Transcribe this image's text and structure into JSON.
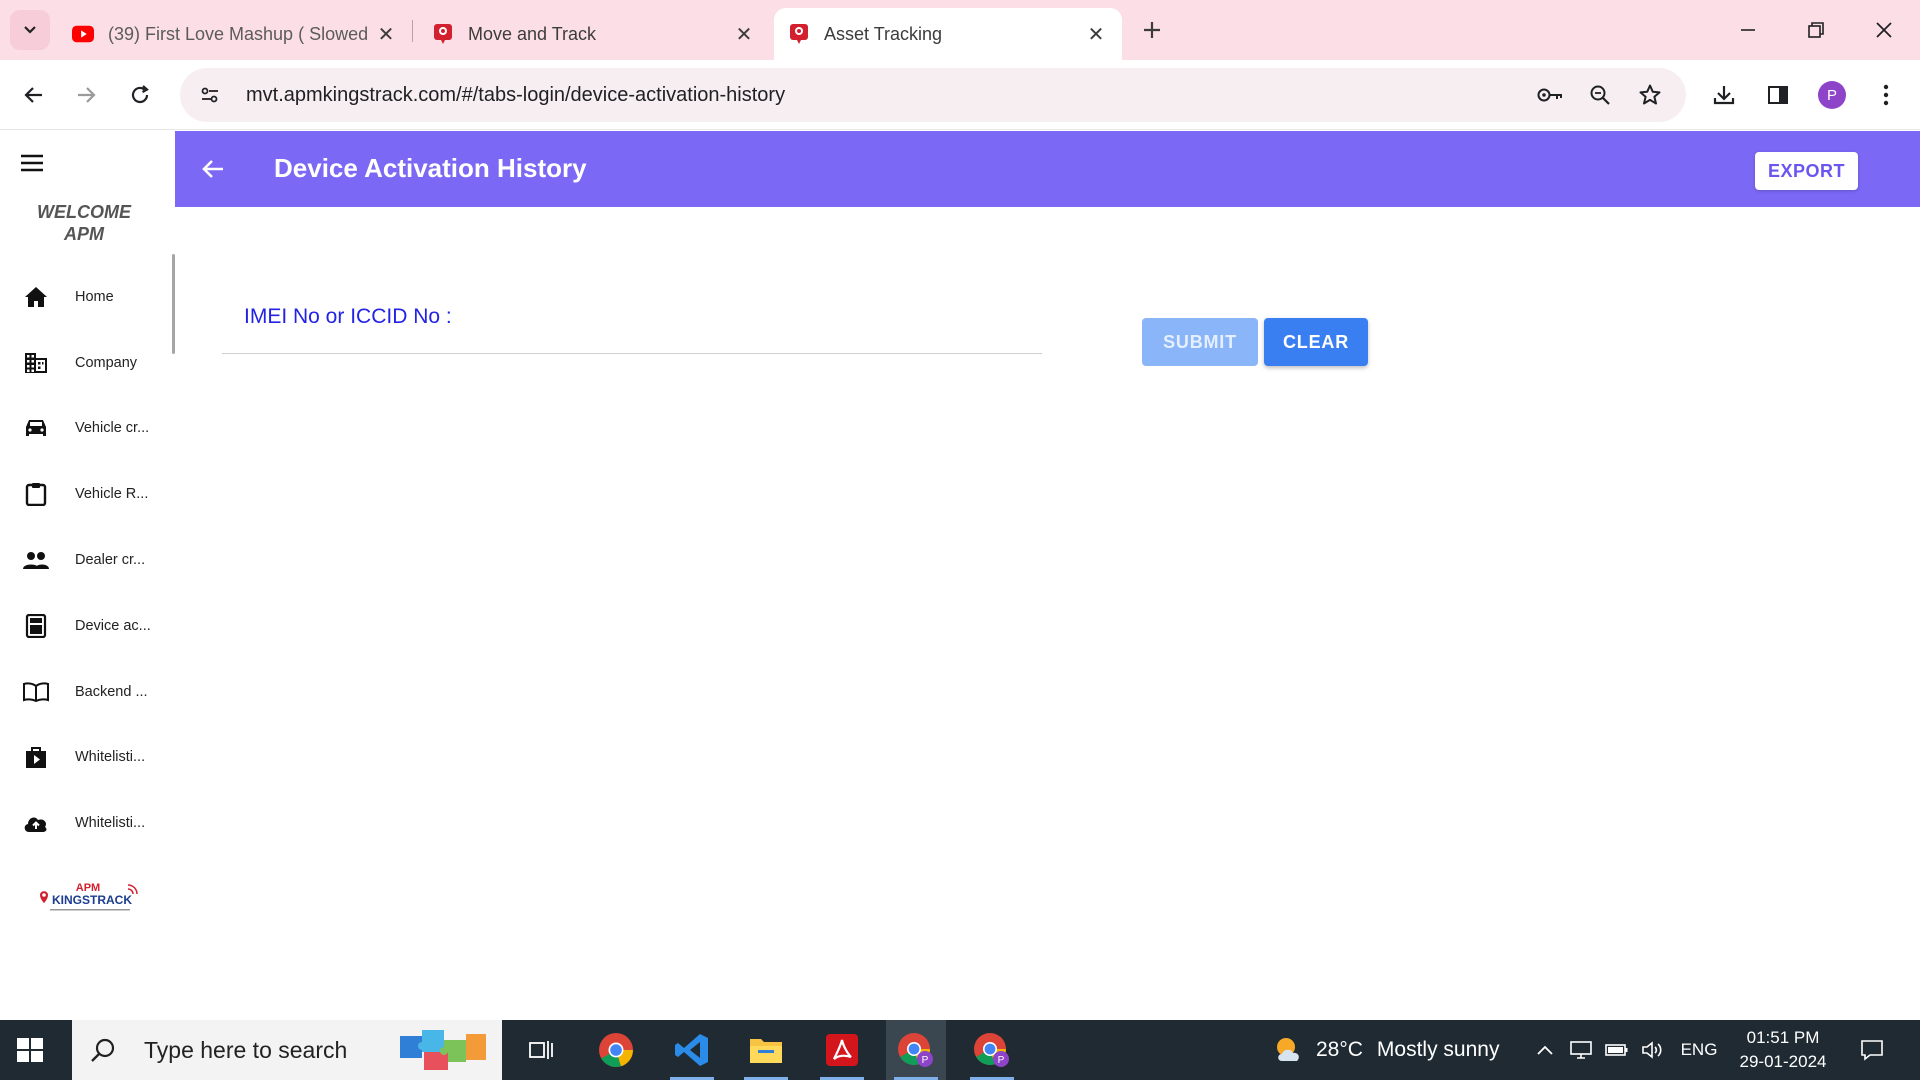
{
  "browser": {
    "tabs": [
      {
        "title": "(39) First Love Mashup ( Slowed",
        "favicon": "youtube-icon",
        "active": false
      },
      {
        "title": "Move and Track",
        "favicon": "location-pin-icon",
        "active": false
      },
      {
        "title": "Asset Tracking",
        "favicon": "location-pin-icon",
        "active": true
      }
    ],
    "url": "mvt.apmkingstrack.com/#/tabs-login/device-activation-history",
    "profile_initial": "P"
  },
  "sidebar": {
    "welcome_line1": "WELCOME",
    "welcome_line2": "APM",
    "items": [
      {
        "label": "Home",
        "icon": "home-icon"
      },
      {
        "label": "Company",
        "icon": "building-icon"
      },
      {
        "label": "Vehicle cr...",
        "icon": "car-icon"
      },
      {
        "label": "Vehicle R...",
        "icon": "clipboard-icon"
      },
      {
        "label": "Dealer cr...",
        "icon": "people-icon"
      },
      {
        "label": "Device ac...",
        "icon": "calculator-icon"
      },
      {
        "label": "Backend ...",
        "icon": "book-icon"
      },
      {
        "label": "Whitelisti...",
        "icon": "shopping-bag-icon"
      },
      {
        "label": "Whitelisti...",
        "icon": "cloud-upload-icon"
      }
    ],
    "logo_top": "APM",
    "logo_main": "KINGSTRACK"
  },
  "header": {
    "title": "Device Activation History",
    "export_label": "EXPORT",
    "color": "#7b68f5"
  },
  "form": {
    "field_label": "IMEI No or ICCID No :",
    "field_value": "",
    "submit_label": "SUBMIT",
    "clear_label": "CLEAR"
  },
  "taskbar": {
    "search_placeholder": "Type here to search",
    "weather_temp": "28°C",
    "weather_desc": "Mostly sunny",
    "language": "ENG",
    "time": "01:51 PM",
    "date": "29-01-2024"
  }
}
